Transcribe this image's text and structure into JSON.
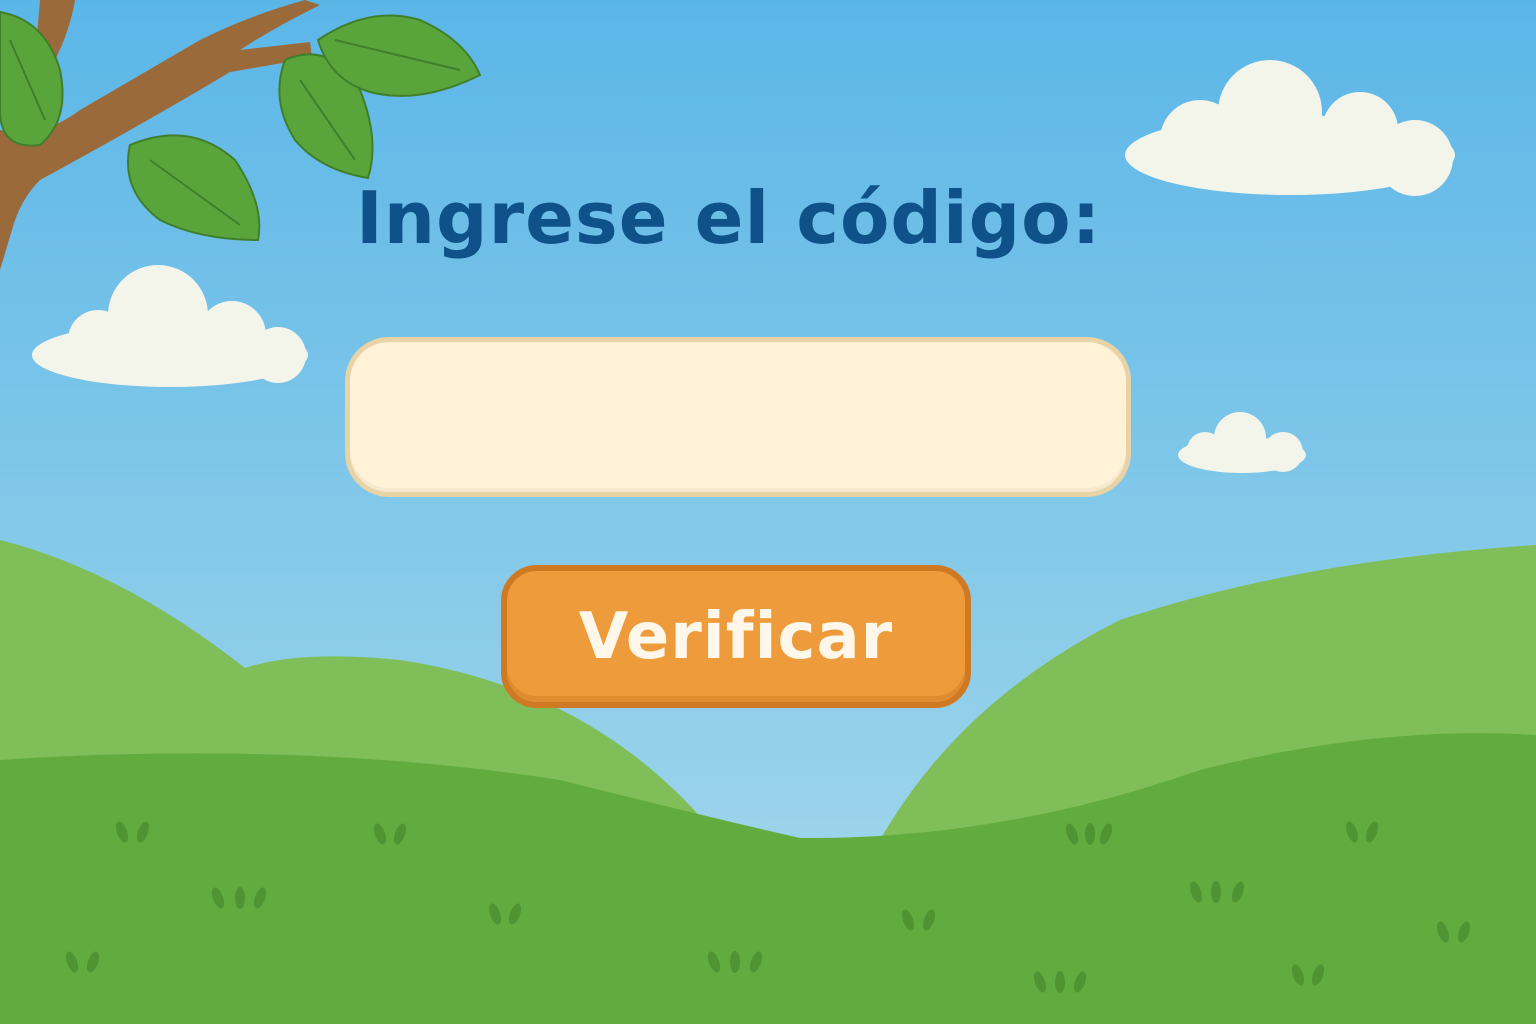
{
  "prompt": {
    "heading": "Ingrese el código:"
  },
  "code_field": {
    "value": "",
    "placeholder": ""
  },
  "actions": {
    "verify_label": "Verificar"
  },
  "colors": {
    "sky_top": "#5bb6e8",
    "sky_bottom": "#a9daea",
    "heading": "#0f5189",
    "field_fill": "#fff2d7",
    "field_border": "#e8d3a6",
    "button_fill": "#ee9c3b",
    "button_border": "#d07923",
    "hill_back": "#7fbe58",
    "hill_front": "#62ab3e",
    "leaf": "#5aa53b",
    "branch": "#9b6a3a",
    "cloud": "#f3f5ea"
  },
  "icons": {
    "clouds": "cloud-icon",
    "branch": "tree-branch-icon",
    "grass": "grass-tuft-icon"
  }
}
